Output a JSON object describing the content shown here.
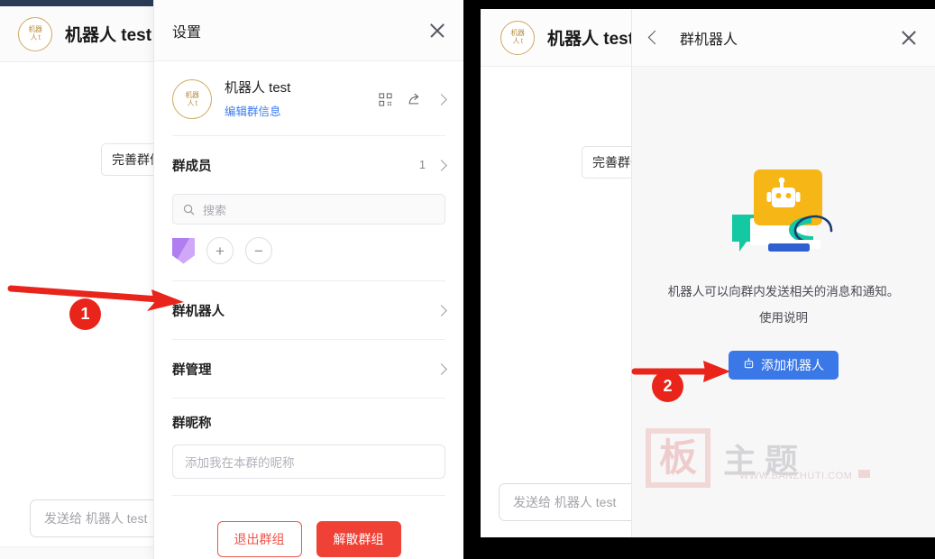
{
  "left_window": {
    "chat": {
      "avatar_line1": "机器",
      "avatar_line2": "人 t",
      "title": "机器人 test",
      "title_suffix": "·",
      "system_chip": "完善群信息",
      "composer_placeholder": "发送给 机器人 test"
    },
    "settings_panel": {
      "header_title": "设置",
      "close_icon": "close-icon",
      "group": {
        "avatar_line1": "机器",
        "avatar_line2": "人 t",
        "name": "机器人 test",
        "edit_link": "编辑群信息",
        "qr_icon": "qr-code-icon",
        "share_icon": "share-icon",
        "chevron_icon": "chevron-right-icon"
      },
      "members": {
        "label": "群成员",
        "count": "1",
        "search_placeholder": "搜索",
        "search_icon": "search-icon",
        "add_label": "+",
        "remove_label": "−"
      },
      "rows": [
        {
          "label": "群机器人"
        },
        {
          "label": "群管理"
        }
      ],
      "nickname": {
        "label": "群昵称",
        "placeholder": "添加我在本群的昵称",
        "value": ""
      },
      "footer": {
        "leave_label": "退出群组",
        "dismiss_label": "解散群组"
      }
    }
  },
  "right_window": {
    "chat": {
      "avatar_line1": "机器",
      "avatar_line2": "人 t",
      "title": "机器人 test",
      "title_suffix": "·",
      "system_chip": "完善群信息",
      "composer_placeholder": "发送给 机器人 test"
    },
    "bot_panel": {
      "back_icon": "chevron-left-icon",
      "header_title": "群机器人",
      "close_icon": "close-icon",
      "illustration": "robot-illustration",
      "description": "机器人可以向群内发送相关的消息和通知。",
      "help_link": "使用说明",
      "add_button_label": "添加机器人",
      "add_button_icon": "robot-icon"
    }
  },
  "watermark": {
    "seal_char": "板",
    "chars": "主题",
    "url": "WWW.BANZHUTI.COM"
  },
  "annotations": [
    {
      "badge": "1"
    },
    {
      "badge": "2"
    }
  ],
  "colors": {
    "accent_blue": "#3b78e7",
    "link_blue": "#3a7cf0",
    "danger_red": "#ef4136",
    "annotation_red": "#e8241b",
    "avatar_gold": "#cfa95f",
    "robot_yellow": "#f5b616",
    "robot_teal": "#13c8a2",
    "robot_blue": "#2f5fd0",
    "member_purple": "#b07ef0"
  }
}
